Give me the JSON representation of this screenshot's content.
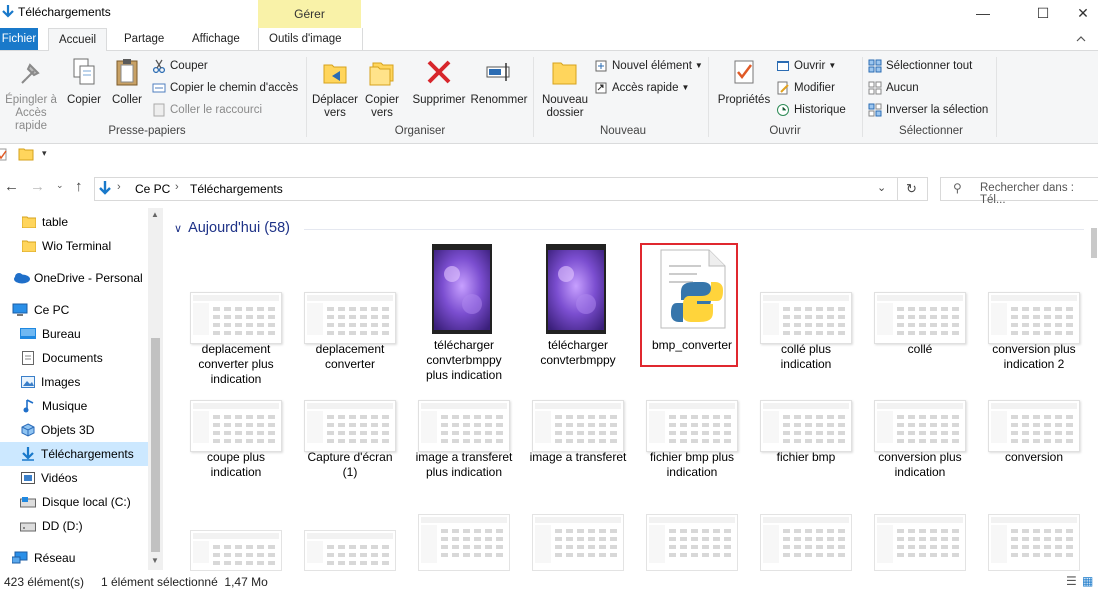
{
  "window": {
    "title": "Téléchargements",
    "context_group": "Gérer",
    "minimize_glyph": "—",
    "maximize_glyph": "☐",
    "close_glyph": "✕"
  },
  "tabs": [
    "Fichier",
    "Accueil",
    "Partage",
    "Affichage",
    "Outils d'image"
  ],
  "ribbon": {
    "presse_papiers": {
      "label": "Presse-papiers",
      "pin": "Épingler à\nAccès rapide",
      "pin_l1": "Épingler à",
      "pin_l2": "Accès rapide",
      "copy": "Copier",
      "paste": "Coller",
      "cut": "Couper",
      "copy_path": "Copier le chemin d'accès",
      "paste_shortcut": "Coller le raccourci"
    },
    "organiser": {
      "label": "Organiser",
      "move_l1": "Déplacer",
      "move_l2": "vers",
      "copy_l1": "Copier",
      "copy_l2": "vers",
      "delete": "Supprimer",
      "rename": "Renommer"
    },
    "nouveau": {
      "label": "Nouveau",
      "folder_l1": "Nouveau",
      "folder_l2": "dossier",
      "new_item": "Nouvel élément",
      "quick_access": "Accès rapide"
    },
    "ouvrir": {
      "label": "Ouvrir",
      "properties": "Propriétés",
      "open": "Ouvrir",
      "edit": "Modifier",
      "history": "Historique"
    },
    "selectionner": {
      "label": "Sélectionner",
      "select_all": "Sélectionner tout",
      "none": "Aucun",
      "invert": "Inverser la sélection"
    }
  },
  "address": {
    "crumbs": [
      "Ce PC",
      "Téléchargements"
    ],
    "search_placeholder": "Rechercher dans : Tél..."
  },
  "sidebar": {
    "items": [
      {
        "label": "table",
        "icon": "folder-icon"
      },
      {
        "label": "Wio Terminal",
        "icon": "folder-icon"
      },
      {
        "label": "OneDrive - Personal",
        "icon": "cloud-icon"
      },
      {
        "label": "Ce PC",
        "icon": "computer-icon"
      },
      {
        "label": "Bureau",
        "icon": "desktop-icon"
      },
      {
        "label": "Documents",
        "icon": "document-icon"
      },
      {
        "label": "Images",
        "icon": "images-icon"
      },
      {
        "label": "Musique",
        "icon": "music-icon"
      },
      {
        "label": "Objets 3D",
        "icon": "cube-icon"
      },
      {
        "label": "Téléchargements",
        "icon": "download-icon",
        "selected": true
      },
      {
        "label": "Vidéos",
        "icon": "video-icon"
      },
      {
        "label": "Disque local (C:)",
        "icon": "drive-icon"
      },
      {
        "label": "DD (D:)",
        "icon": "drive-icon"
      },
      {
        "label": "Réseau",
        "icon": "network-icon"
      }
    ]
  },
  "content": {
    "group_header": "Aujourd'hui (58)",
    "files": [
      {
        "name": "deplacement converter plus indication",
        "kind": "screenshot"
      },
      {
        "name": "deplacement converter",
        "kind": "screenshot"
      },
      {
        "name": "télécharger convterbmppy plus indication",
        "kind": "image"
      },
      {
        "name": "télécharger convterbmppy",
        "kind": "image"
      },
      {
        "name": "bmp_converter",
        "kind": "python",
        "selected": true
      },
      {
        "name": "collé plus indication",
        "kind": "screenshot"
      },
      {
        "name": "collé",
        "kind": "screenshot"
      },
      {
        "name": "conversion plus indication 2",
        "kind": "screenshot"
      },
      {
        "name": "coupe plus indication",
        "kind": "screenshot"
      },
      {
        "name": "Capture d'écran (1)",
        "kind": "screenshot"
      },
      {
        "name": "image a transferet plus indication",
        "kind": "screenshot"
      },
      {
        "name": "image a transferet",
        "kind": "screenshot"
      },
      {
        "name": "fichier bmp plus indication",
        "kind": "screenshot"
      },
      {
        "name": "fichier bmp",
        "kind": "screenshot"
      },
      {
        "name": "conversion plus indication",
        "kind": "screenshot"
      },
      {
        "name": "conversion",
        "kind": "screenshot"
      }
    ]
  },
  "status": {
    "count": "423 élément(s)",
    "selection": "1 élément sélectionné  1,47 Mo"
  },
  "colors": {
    "accent": "#1979ca",
    "selection": "#cce8ff",
    "highlight_box": "#e0282f",
    "context_tab": "#f9f2a8"
  }
}
